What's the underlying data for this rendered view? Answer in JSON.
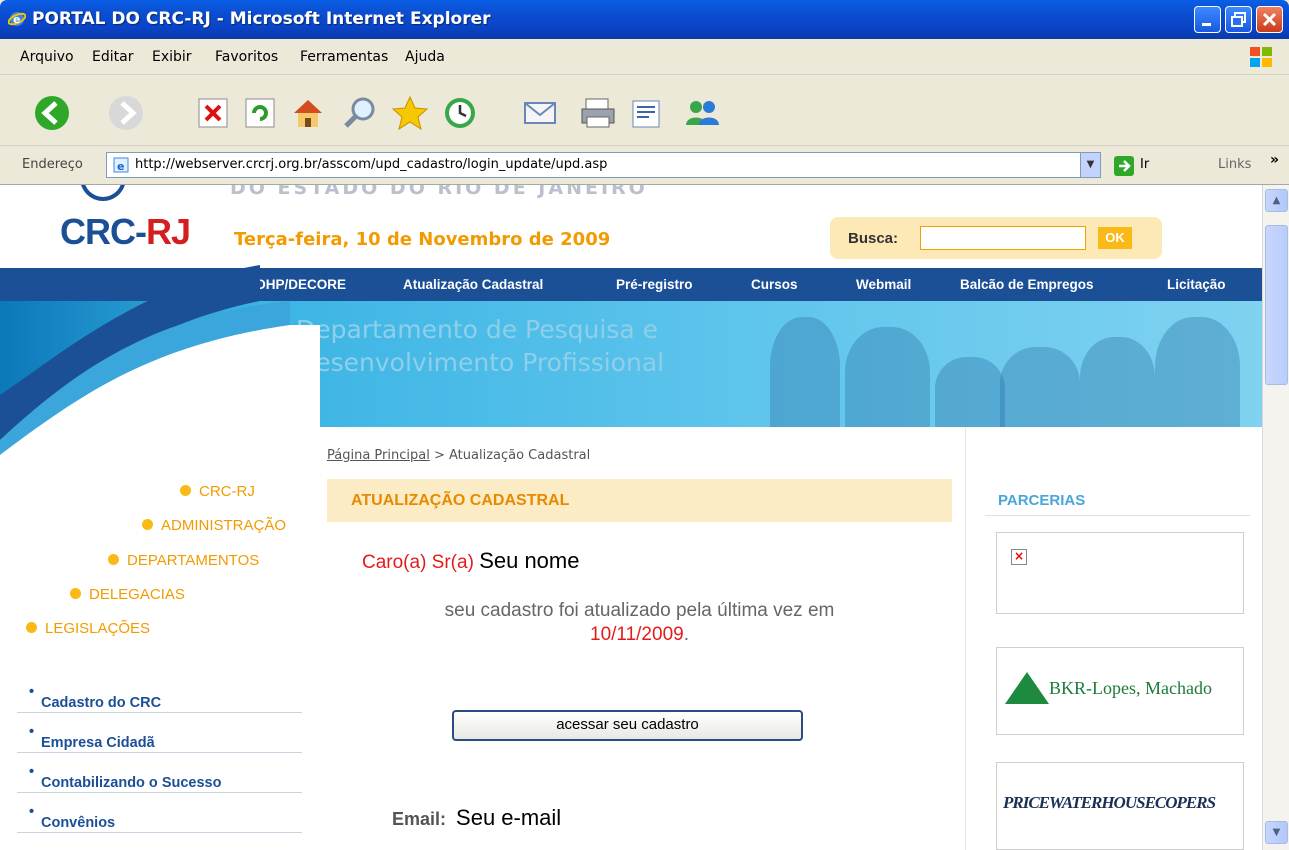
{
  "window": {
    "title": "PORTAL DO CRC-RJ - Microsoft Internet Explorer"
  },
  "menu": [
    "Arquivo",
    "Editar",
    "Exibir",
    "Favoritos",
    "Ferramentas",
    "Ajuda"
  ],
  "address": {
    "label": "Endereço",
    "url": "http://webserver.crcrj.org.br/asscom/upd_cadastro/login_update/upd.asp",
    "go_label": "Ir",
    "links_label": "Links"
  },
  "toolbar_icons": [
    "back-icon",
    "forward-icon",
    "stop-icon",
    "refresh-icon",
    "home-icon",
    "search-icon",
    "favorites-icon",
    "history-icon",
    "mail-icon",
    "print-icon",
    "edit-icon",
    "messenger-icon"
  ],
  "page": {
    "header_top": "DO ESTADO DO RIO DE JANEIRO",
    "logo_crc": "CRC-",
    "logo_rj": "RJ",
    "date": "Terça-feira, 10 de Novembro de 2009",
    "search": {
      "label": "Busca:",
      "button": "OK"
    },
    "nav": [
      "DHP/DECORE",
      "Atualização Cadastral",
      "Pré-registro",
      "Cursos",
      "Webmail",
      "Balcão de Empregos",
      "Licitação"
    ],
    "banner": {
      "line1": "Departamento de Pesquisa e",
      "line2": "Desenvolvimento Profissional"
    },
    "breadcrumb": {
      "home": "Página Principal",
      "sep": " > ",
      "current": "Atualização Cadastral"
    },
    "section_title": "ATUALIZAÇÃO CADASTRAL",
    "greeting": {
      "prefix": "Caro(a) Sr(a)",
      "name": "Seu nome"
    },
    "info": {
      "text": "seu cadastro foi atualizado pela última vez em",
      "date": "10/11/2009",
      "period": "."
    },
    "access_button": "acessar seu cadastro",
    "email": {
      "label": "Email:",
      "value": "Seu e-mail"
    },
    "left_menu": [
      "CRC-RJ",
      "ADMINISTRAÇÃO",
      "DEPARTAMENTOS",
      "DELEGACIAS",
      "LEGISLAÇÕES"
    ],
    "left_list": [
      "Cadastro do CRC",
      "Empresa Cidadã",
      "Contabilizando o Sucesso",
      "Convênios"
    ],
    "partners_title": "PARCERIAS",
    "partners": [
      "BKR-Lopes, Machado",
      "PRICEWATERHOUSECOPERS"
    ]
  },
  "colors": {
    "brand_blue": "#1b4f96",
    "orange": "#f29b00",
    "red": "#e51b1b",
    "title_blue": "#0a44c8"
  }
}
